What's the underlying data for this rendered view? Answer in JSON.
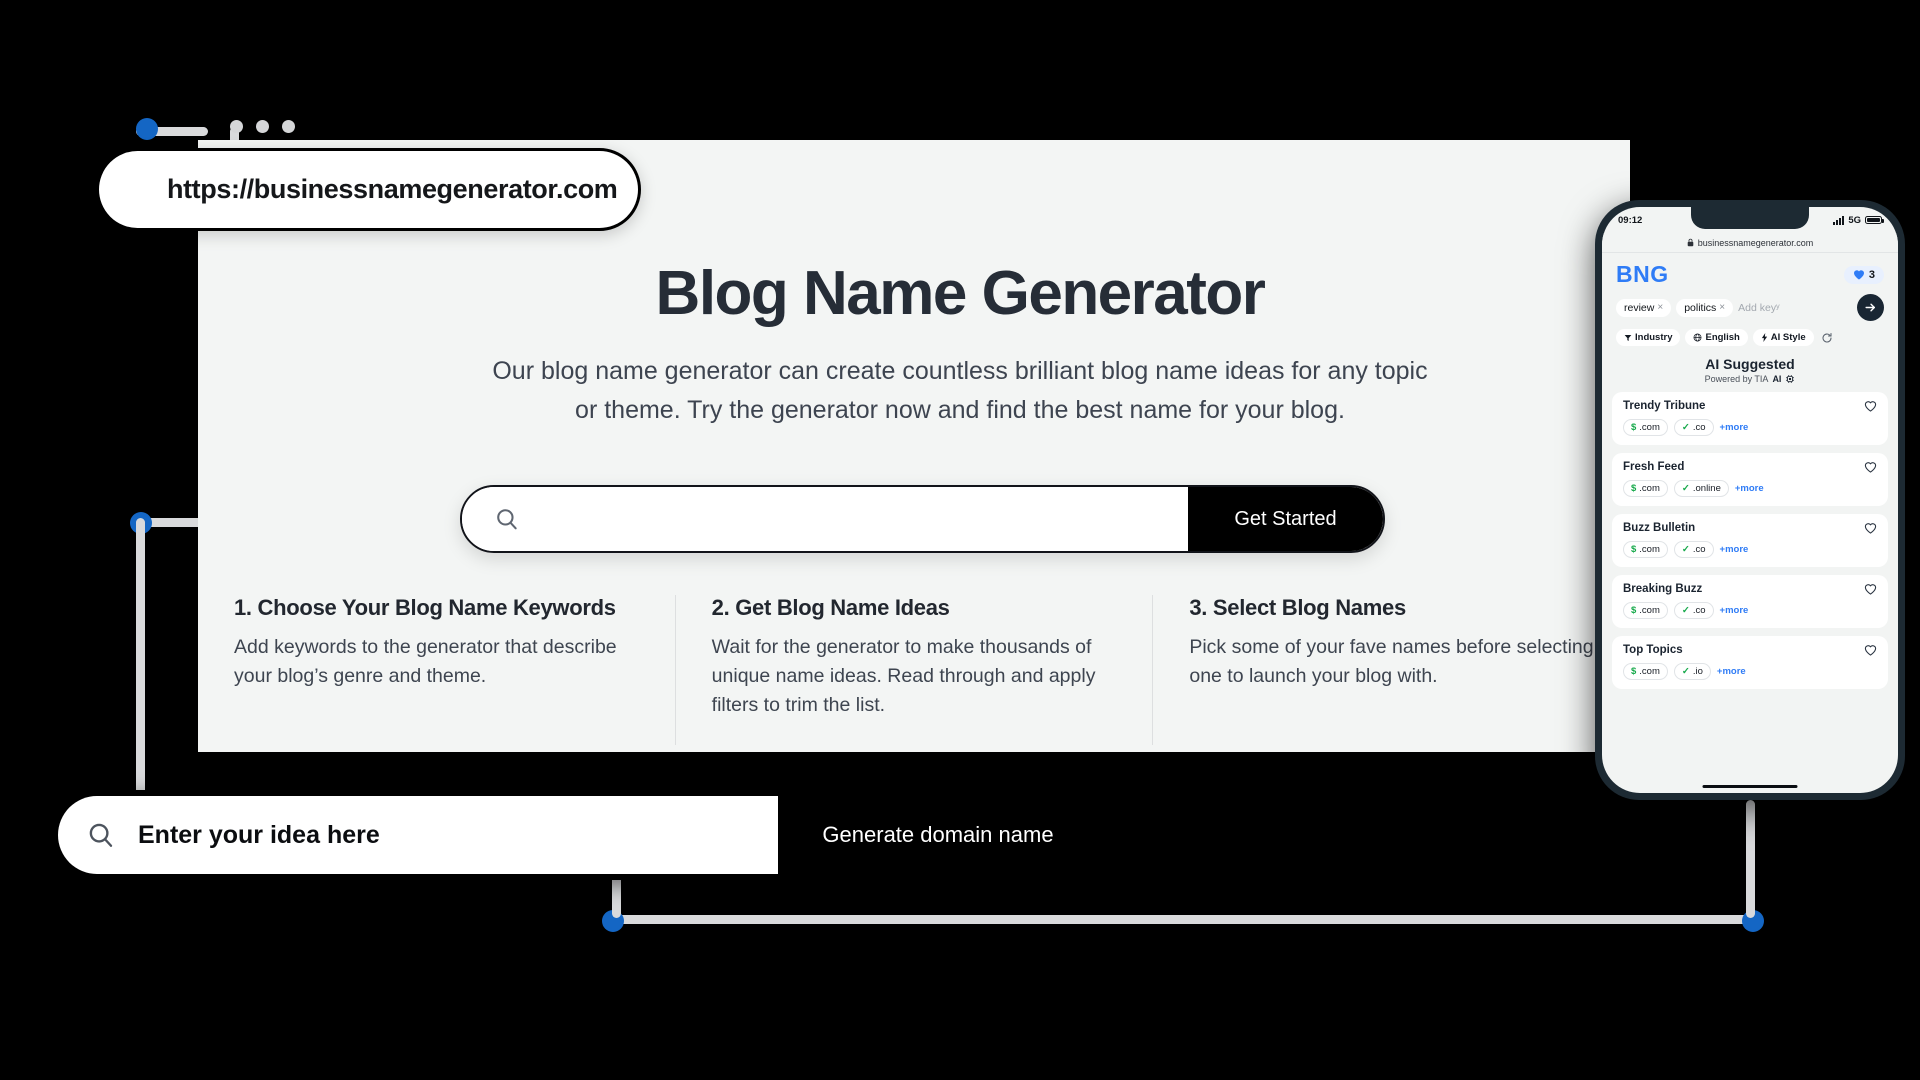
{
  "browser": {
    "url": "https://businessnamegenerator.com",
    "dots_count": 3
  },
  "hero": {
    "title": "Blog Name Generator",
    "subtitle_line1": "Our blog name generator can create countless brilliant blog name ideas for any topic",
    "subtitle_line2": "or theme. Try the generator now and find the best name for your blog."
  },
  "search": {
    "placeholder": "",
    "value": "",
    "button_label": "Get Started",
    "icon": "search-icon"
  },
  "steps": [
    {
      "title": "1. Choose Your Blog Name Keywords",
      "body": "Add keywords to the generator that describe your blog’s genre and theme."
    },
    {
      "title": "2. Get Blog Name Ideas",
      "body": "Wait for the generator to make thousands of unique name ideas. Read through and apply filters to trim the list."
    },
    {
      "title": "3. Select Blog Names",
      "body": "Pick some of your fave names before selecting one to launch your blog with."
    }
  ],
  "bottom_bar": {
    "placeholder": "Enter your idea here",
    "button_label": "Generate domain name",
    "icon": "search-icon"
  },
  "phone": {
    "status": {
      "time": "09:12",
      "network": "5G",
      "signal_icon": "signal-bars-icon",
      "battery_icon": "battery-icon"
    },
    "browser_url": "businessnamegenerator.com",
    "lock_icon": "lock-icon",
    "logo": "BNG",
    "favourites": {
      "icon": "heart-filled-icon",
      "count": "3"
    },
    "keywords": [
      {
        "label": "review",
        "remove": "×"
      },
      {
        "label": "politics",
        "remove": "×"
      }
    ],
    "keyword_placeholder": "Add keyʸ",
    "submit_icon": "arrow-right-icon",
    "filters": [
      {
        "icon": "funnel-icon",
        "label": "Industry"
      },
      {
        "icon": "globe-icon",
        "label": "English"
      },
      {
        "icon": "bolt-icon",
        "label": "AI Style"
      }
    ],
    "refresh_icon": "refresh-icon",
    "ai_heading": "AI Suggested",
    "ai_subheading": "Powered by TIA",
    "ai_subheading_bold": "AI",
    "ai_chip_icon": "chip-icon",
    "results": [
      {
        "name": "Trendy Tribune",
        "heart": "heart-outline-icon",
        "domains": [
          {
            "icon": "dollar-icon",
            "tld": ".com"
          },
          {
            "icon": "check-icon",
            "tld": ".co"
          }
        ],
        "more": "+more"
      },
      {
        "name": "Fresh Feed",
        "heart": "heart-outline-icon",
        "domains": [
          {
            "icon": "dollar-icon",
            "tld": ".com"
          },
          {
            "icon": "check-icon",
            "tld": ".online"
          }
        ],
        "more": "+more"
      },
      {
        "name": "Buzz Bulletin",
        "heart": "heart-outline-icon",
        "domains": [
          {
            "icon": "dollar-icon",
            "tld": ".com"
          },
          {
            "icon": "check-icon",
            "tld": ".co"
          }
        ],
        "more": "+more"
      },
      {
        "name": "Breaking Buzz",
        "heart": "heart-outline-icon",
        "domains": [
          {
            "icon": "dollar-icon",
            "tld": ".com"
          },
          {
            "icon": "check-icon",
            "tld": ".co"
          }
        ],
        "more": "+more"
      },
      {
        "name": "Top Topics",
        "heart": "heart-outline-icon",
        "domains": [
          {
            "icon": "dollar-icon",
            "tld": ".com"
          },
          {
            "icon": "check-icon",
            "tld": ".io"
          }
        ],
        "more": "+more"
      }
    ]
  },
  "colors": {
    "accent_blue": "#1466c4",
    "link_blue": "#2f7cf6",
    "logo_blue": "#2f7cf6",
    "green": "#16a94a",
    "dark": "#000000",
    "page_bg": "#f3f5f4",
    "heading": "#262d37"
  }
}
